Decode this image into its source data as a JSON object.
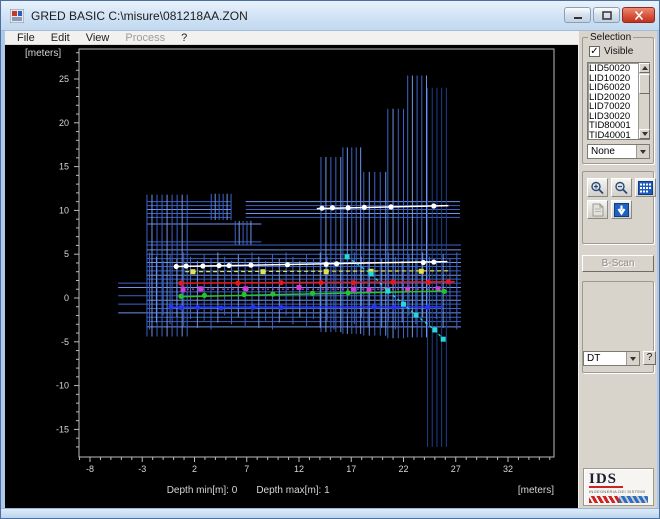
{
  "window": {
    "title": "GRED BASIC C:\\misure\\081218AA.ZON"
  },
  "menu": {
    "items": [
      {
        "label": "File",
        "enabled": true
      },
      {
        "label": "Edit",
        "enabled": true
      },
      {
        "label": "View",
        "enabled": true
      },
      {
        "label": "Process",
        "enabled": false
      },
      {
        "label": "?",
        "enabled": true
      }
    ]
  },
  "sidebar": {
    "selection": {
      "legend": "Selection",
      "visible_checkbox": {
        "label": "Visible",
        "checked": true,
        "glyph": "✓"
      },
      "list_items": [
        "LID50020",
        "LID10020",
        "LID60020",
        "LID20020",
        "LID70020",
        "LID30020",
        "TID80001",
        "TID40001"
      ],
      "dropdown_value": "None"
    },
    "tools": {
      "icons": [
        "zoom-in-icon",
        "zoom-out-icon",
        "grid-view-icon",
        "report-icon",
        "download-arrow-icon"
      ]
    },
    "bscan_button": {
      "label": "B-Scan",
      "enabled": false
    },
    "dt": {
      "dropdown_value": "DT",
      "help_label": "?"
    },
    "logo": {
      "text": "IDS",
      "subtext": "INGEGNERIA DEI SISTEMI"
    }
  },
  "footer": {
    "depth_min": "Depth min[m]: 0",
    "depth_max": "Depth max[m]: 1",
    "unit_right": "[meters]",
    "unit_top_left": "[meters]"
  },
  "chart_data": {
    "type": "scatter",
    "title": "",
    "xlabel": "[meters]",
    "ylabel": "[meters]",
    "xlim": [
      -9,
      36.4
    ],
    "ylim": [
      -18.1,
      28.4
    ],
    "xticks": [
      -8,
      -3,
      2,
      7,
      12,
      17,
      22,
      27,
      32
    ],
    "yticks": [
      25,
      20,
      15,
      10,
      5,
      0,
      -5,
      -10,
      -15
    ],
    "grid": false,
    "legend": "none",
    "axis_color": "#bdbdbd",
    "label_color": "#d6d6d6",
    "colors": {
      "blue": "#3c63c6",
      "blue_light": "#7094e8",
      "blue_dark": "#1e3f8c"
    },
    "hlines": [
      {
        "y": 11.0,
        "x1": -2.5,
        "x2": 5.5
      },
      {
        "y": 11.0,
        "x1": 6.9,
        "x2": 27.4
      },
      {
        "y": 10.55,
        "x1": -2.5,
        "x2": 5.5
      },
      {
        "y": 10.55,
        "x1": 6.9,
        "x2": 27.4
      },
      {
        "y": 10.1,
        "x1": -2.5,
        "x2": 5.5
      },
      {
        "y": 10.1,
        "x1": 6.9,
        "x2": 27.4
      },
      {
        "y": 9.65,
        "x1": -2.5,
        "x2": 5.5
      },
      {
        "y": 9.65,
        "x1": 6.9,
        "x2": 27.4
      },
      {
        "y": 9.2,
        "x1": -2.5,
        "x2": 5.5
      },
      {
        "y": 9.2,
        "x1": 6.9,
        "x2": 27.4
      },
      {
        "y": 8.45,
        "x1": -2.5,
        "x2": 8.4
      },
      {
        "y": 6.4,
        "x1": -2.5,
        "x2": 8.4
      },
      {
        "y": 6.05,
        "x1": -2.6,
        "x2": 27.5
      },
      {
        "y": 5.5,
        "x1": -2.6,
        "x2": 27.5
      },
      {
        "y": 5.0,
        "x1": -2.6,
        "x2": 27.5
      },
      {
        "y": 4.5,
        "x1": -2.6,
        "x2": 27.5
      },
      {
        "y": 4.05,
        "x1": -2.6,
        "x2": 27.5
      },
      {
        "y": 3.6,
        "x1": -2.6,
        "x2": 27.5
      },
      {
        "y": 3.1,
        "x1": -2.6,
        "x2": 27.5
      },
      {
        "y": 2.6,
        "x1": -2.6,
        "x2": 27.5
      },
      {
        "y": 2.15,
        "x1": -2.6,
        "x2": 27.5
      },
      {
        "y": 1.7,
        "x1": -5.3,
        "x2": 27.5
      },
      {
        "y": 1.2,
        "x1": -5.3,
        "x2": 27.5
      },
      {
        "y": 0.7,
        "x1": -2.6,
        "x2": 27.5
      },
      {
        "y": 0.25,
        "x1": -5.3,
        "x2": 27.5
      },
      {
        "y": -0.25,
        "x1": -2.6,
        "x2": 27.5
      },
      {
        "y": -0.7,
        "x1": -5.3,
        "x2": 27.5
      },
      {
        "y": -1.2,
        "x1": -2.6,
        "x2": 27.5
      },
      {
        "y": -1.7,
        "x1": -5.3,
        "x2": 27.5
      },
      {
        "y": -2.2,
        "x1": -2.6,
        "x2": 27.5
      },
      {
        "y": -2.7,
        "x1": -2.6,
        "x2": 27.5
      },
      {
        "y": -3.3,
        "x1": -2.6,
        "x2": 27.5
      }
    ],
    "vgroups": [
      {
        "x1": -2.55,
        "x2": 1.3,
        "n": 9,
        "y1": 11.8,
        "y2": -4.4
      },
      {
        "x1": 3.6,
        "x2": 5.5,
        "n": 6,
        "y1": 11.9,
        "y2": 8.9
      },
      {
        "x1": 5.9,
        "x2": 7.4,
        "n": 5,
        "y1": 8.8,
        "y2": 6.1
      },
      {
        "x1": 14.1,
        "x2": 16.0,
        "n": 5,
        "y1": 16.1,
        "y2": -3.9
      },
      {
        "x1": 16.2,
        "x2": 17.9,
        "n": 5,
        "y1": 17.2,
        "y2": -4.1
      },
      {
        "x1": 18.2,
        "x2": 20.3,
        "n": 5,
        "y1": 14.4,
        "y2": -4.3
      },
      {
        "x1": 20.5,
        "x2": 22.0,
        "n": 4,
        "y1": 21.6,
        "y2": -4.6
      },
      {
        "x1": 22.4,
        "x2": 24.2,
        "n": 5,
        "y1": 25.4,
        "y2": -4.5
      },
      {
        "x1": 24.3,
        "x2": 26.1,
        "n": 5,
        "y1": 24.0,
        "y2": -17.0,
        "color": "#1e3f8c"
      },
      {
        "x1": -2.3,
        "x2": 27.1,
        "n": 46,
        "y1": 5.2,
        "y2": -3.6,
        "jitter": true
      }
    ],
    "series": [
      {
        "name": "white-top-line",
        "color": "#ffffff",
        "marker": "circle",
        "width": 1.5,
        "line": [
          [
            13.7,
            10.2
          ],
          [
            26.3,
            10.55
          ]
        ],
        "points": [
          [
            14.2,
            10.25
          ],
          [
            15.2,
            10.3
          ],
          [
            16.7,
            10.3
          ],
          [
            18.25,
            10.35
          ],
          [
            20.8,
            10.4
          ],
          [
            24.9,
            10.5
          ]
        ]
      },
      {
        "name": "white-mid-line",
        "color": "#ffffff",
        "marker": "circle",
        "width": 1.5,
        "line": [
          [
            0.2,
            3.6
          ],
          [
            26.2,
            4.15
          ]
        ],
        "points": [
          [
            0.25,
            3.6
          ],
          [
            1.2,
            3.65
          ],
          [
            2.8,
            3.65
          ],
          [
            4.35,
            3.7
          ],
          [
            5.3,
            3.7
          ],
          [
            7.4,
            3.75
          ],
          [
            10.9,
            3.8
          ],
          [
            14.6,
            3.85
          ],
          [
            15.6,
            3.9
          ],
          [
            23.9,
            4.05
          ],
          [
            24.9,
            4.1
          ]
        ]
      },
      {
        "name": "yellow-line",
        "color": "#e3e34e",
        "marker": "square",
        "dash": "4,3",
        "width": 1.2,
        "line": [
          [
            1.1,
            3.0
          ],
          [
            26.4,
            3.1
          ]
        ],
        "points": [
          [
            1.85,
            3.0
          ],
          [
            8.55,
            3.0
          ],
          [
            14.6,
            3.0
          ],
          [
            18.9,
            3.05
          ],
          [
            23.7,
            3.05
          ]
        ]
      },
      {
        "name": "red-line",
        "color": "#ee1515",
        "marker": "circle",
        "width": 1.5,
        "line": [
          [
            0.55,
            1.7
          ],
          [
            26.9,
            1.85
          ]
        ],
        "points": [
          [
            0.7,
            1.7
          ],
          [
            6.15,
            1.7
          ],
          [
            10.3,
            1.75
          ],
          [
            14.1,
            1.75
          ],
          [
            17.2,
            1.75
          ],
          [
            21.0,
            1.8
          ],
          [
            24.4,
            1.8
          ],
          [
            26.3,
            1.85
          ]
        ]
      },
      {
        "name": "magenta-line",
        "color": "#d63ad6",
        "marker": "square",
        "dash": "2,3",
        "width": 1.1,
        "line": [
          [
            0.8,
            1.0
          ],
          [
            26.0,
            1.0
          ]
        ],
        "points": [
          [
            0.9,
            1.0
          ],
          [
            2.6,
            1.05
          ],
          [
            6.9,
            1.05
          ],
          [
            12.0,
            1.2
          ],
          [
            17.2,
            1.0
          ],
          [
            18.7,
            0.95
          ],
          [
            20.5,
            0.9
          ],
          [
            22.4,
            1.0
          ],
          [
            25.3,
            1.05
          ]
        ]
      },
      {
        "name": "green-line",
        "color": "#27c427",
        "marker": "circle",
        "width": 1.5,
        "line": [
          [
            0.55,
            0.15
          ],
          [
            26.1,
            0.8
          ]
        ],
        "points": [
          [
            0.7,
            0.2
          ],
          [
            2.95,
            0.3
          ],
          [
            6.75,
            0.4
          ],
          [
            9.5,
            0.45
          ],
          [
            13.3,
            0.55
          ],
          [
            16.7,
            0.6
          ],
          [
            25.9,
            0.75
          ]
        ]
      },
      {
        "name": "blue-line",
        "color": "#2736ee",
        "marker": "circle",
        "width": 1.6,
        "line": [
          [
            -0.35,
            -1.05
          ],
          [
            25.9,
            -1.0
          ]
        ],
        "points": [
          [
            -0.25,
            -1.0
          ],
          [
            0.7,
            -1.1
          ],
          [
            2.3,
            -1.1
          ],
          [
            4.55,
            -1.15
          ],
          [
            7.6,
            -1.05
          ],
          [
            10.3,
            -1.1
          ],
          [
            19.2,
            -1.0
          ],
          [
            21.1,
            -1.05
          ],
          [
            24.3,
            -1.05
          ]
        ]
      },
      {
        "name": "cyan-descending-line",
        "color": "#27d8d8",
        "marker": "square",
        "dash": "3,3",
        "width": 1.2,
        "line": null,
        "points": [
          [
            16.6,
            4.7
          ],
          [
            18.9,
            2.75
          ],
          [
            20.5,
            0.8
          ],
          [
            22.0,
            -0.7
          ],
          [
            23.2,
            -1.95
          ],
          [
            25.0,
            -3.65
          ],
          [
            25.8,
            -4.7
          ]
        ]
      }
    ]
  }
}
